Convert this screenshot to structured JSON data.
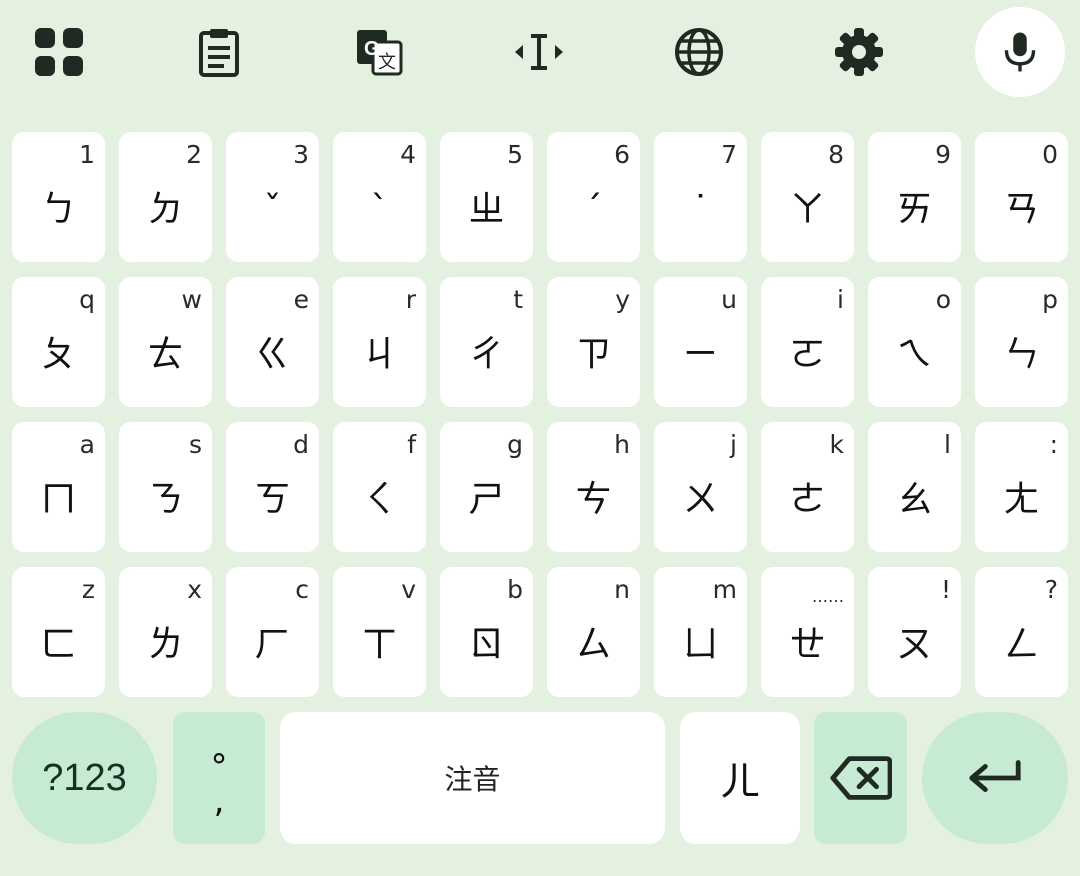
{
  "toolbar": {
    "icons": [
      "grid-apps-icon",
      "clipboard-icon",
      "translate-icon",
      "text-cursor-icon",
      "globe-icon",
      "gear-icon",
      "mic-icon"
    ]
  },
  "rows": [
    [
      {
        "hint": "1",
        "glyph": "ㄅ"
      },
      {
        "hint": "2",
        "glyph": "ㄉ"
      },
      {
        "hint": "3",
        "glyph": "ˇ"
      },
      {
        "hint": "4",
        "glyph": "ˋ"
      },
      {
        "hint": "5",
        "glyph": "ㄓ"
      },
      {
        "hint": "6",
        "glyph": "ˊ"
      },
      {
        "hint": "7",
        "glyph": "˙"
      },
      {
        "hint": "8",
        "glyph": "ㄚ"
      },
      {
        "hint": "9",
        "glyph": "ㄞ"
      },
      {
        "hint": "0",
        "glyph": "ㄢ"
      }
    ],
    [
      {
        "hint": "q",
        "glyph": "ㄆ"
      },
      {
        "hint": "w",
        "glyph": "ㄊ"
      },
      {
        "hint": "e",
        "glyph": "ㄍ"
      },
      {
        "hint": "r",
        "glyph": "ㄐ"
      },
      {
        "hint": "t",
        "glyph": "ㄔ"
      },
      {
        "hint": "y",
        "glyph": "ㄗ"
      },
      {
        "hint": "u",
        "glyph": "ㄧ"
      },
      {
        "hint": "i",
        "glyph": "ㄛ"
      },
      {
        "hint": "o",
        "glyph": "ㄟ"
      },
      {
        "hint": "p",
        "glyph": "ㄣ"
      }
    ],
    [
      {
        "hint": "a",
        "glyph": "ㄇ"
      },
      {
        "hint": "s",
        "glyph": "ㄋ"
      },
      {
        "hint": "d",
        "glyph": "ㄎ"
      },
      {
        "hint": "f",
        "glyph": "ㄑ"
      },
      {
        "hint": "g",
        "glyph": "ㄕ"
      },
      {
        "hint": "h",
        "glyph": "ㄘ"
      },
      {
        "hint": "j",
        "glyph": "ㄨ"
      },
      {
        "hint": "k",
        "glyph": "ㄜ"
      },
      {
        "hint": "l",
        "glyph": "ㄠ"
      },
      {
        "hint": ":",
        "glyph": "ㄤ"
      }
    ],
    [
      {
        "hint": "z",
        "glyph": "ㄈ"
      },
      {
        "hint": "x",
        "glyph": "ㄌ"
      },
      {
        "hint": "c",
        "glyph": "ㄏ"
      },
      {
        "hint": "v",
        "glyph": "ㄒ"
      },
      {
        "hint": "b",
        "glyph": "ㄖ"
      },
      {
        "hint": "n",
        "glyph": "ㄙ"
      },
      {
        "hint": "m",
        "glyph": "ㄩ"
      },
      {
        "hint": "……",
        "glyph": "ㄝ"
      },
      {
        "hint": "!",
        "glyph": "ㄡ"
      },
      {
        "hint": "?",
        "glyph": "ㄥ"
      }
    ]
  ],
  "bottom": {
    "num_label": "?123",
    "punct_top": "°",
    "punct_bottom": ",",
    "space_label": "注音",
    "er_label": "ㄦ",
    "delete_icon": "backspace-icon",
    "enter_icon": "enter-arrow-icon"
  },
  "colors": {
    "background": "#e4f1e0",
    "key": "#ffffff",
    "accent_key": "#c7ead2",
    "icon": "#1f2a22"
  }
}
